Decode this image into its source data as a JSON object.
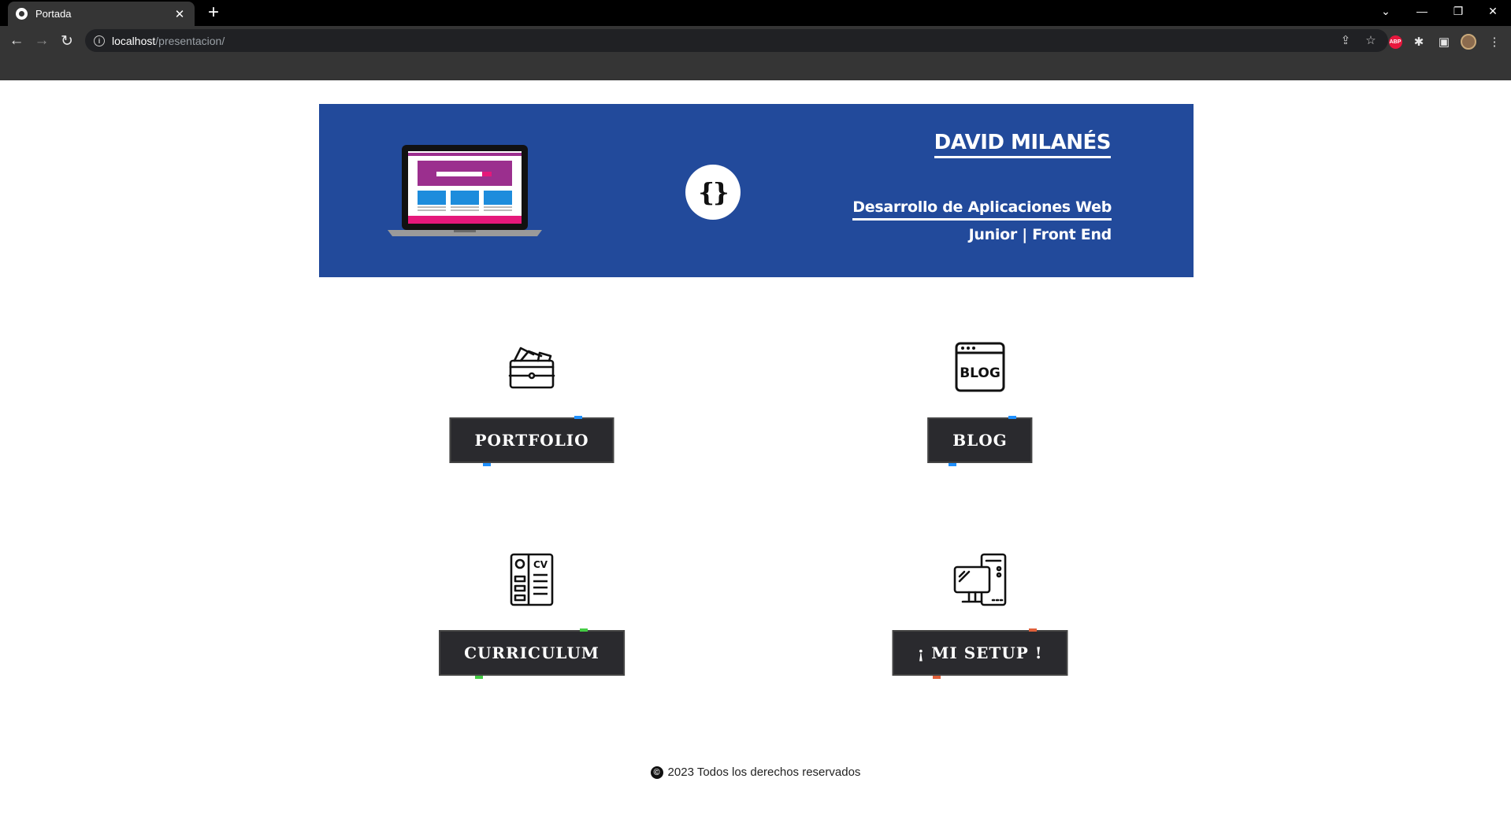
{
  "browser": {
    "tab_title": "Portada",
    "tab_close": "✕",
    "new_tab": "+",
    "url_host": "localhost",
    "url_path": "/presentacion/",
    "back": "←",
    "forward": "→",
    "reload": "↻",
    "minimize": "—",
    "restore": "❐",
    "close": "✕",
    "tab_list": "⌄",
    "info": "i",
    "share": "⇪",
    "bookmark": "☆",
    "abp": "ABP",
    "extensions": "✱",
    "sidepanel": "▣",
    "menu": "⋮"
  },
  "banner": {
    "background": "#224a9b",
    "name": "DAVID MILANÉS",
    "role": "Desarrollo de Aplicaciones Web",
    "level": "Junior | Front End",
    "logo": "{}"
  },
  "cards": {
    "portfolio": {
      "label": "PORTFOLIO",
      "icon": "wallet-icon",
      "accent": "#1e90ff"
    },
    "blog": {
      "label": "BLOG",
      "icon": "blog-icon",
      "icon_text": "BLOG",
      "accent": "#1e90ff"
    },
    "curriculum": {
      "label": "CURRICULUM",
      "icon": "cv-icon",
      "icon_text": "CV",
      "accent": "#44cc44"
    },
    "setup": {
      "label": "¡ MI SETUP !",
      "icon": "computer-setup-icon",
      "accent": "#e0603a"
    }
  },
  "footer": {
    "icon": "©",
    "text": "2023 Todos los derechos reservados"
  }
}
